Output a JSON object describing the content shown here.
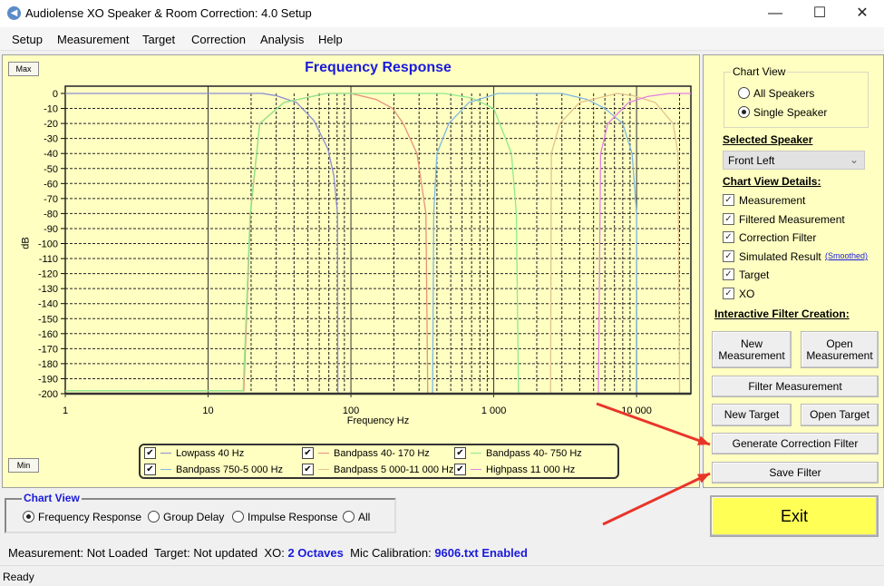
{
  "window": {
    "title": "Audiolense XO Speaker & Room Correction: 4.0 Setup",
    "minimize": "—",
    "maximize": "☐",
    "close": "✕"
  },
  "menu": [
    "Setup",
    "Measurement",
    "Target",
    "Correction",
    "Analysis",
    "Help"
  ],
  "chart_panel": {
    "max_label": "Max",
    "min_label": "Min"
  },
  "chart_data": {
    "type": "line",
    "title": "Frequency Response",
    "xlabel": "Frequency Hz",
    "ylabel": "dB",
    "xscale": "log",
    "xlim": [
      1,
      24000
    ],
    "ylim": [
      -200,
      0
    ],
    "xticks": [
      {
        "v": 1,
        "label": "1"
      },
      {
        "v": 10,
        "label": "10"
      },
      {
        "v": 100,
        "label": "100"
      },
      {
        "v": 1000,
        "label": "1 000"
      },
      {
        "v": 10000,
        "label": "10 000"
      }
    ],
    "yticks": [
      0,
      -10,
      -20,
      -30,
      -40,
      -50,
      -60,
      -70,
      -80,
      -90,
      -100,
      -110,
      -120,
      -130,
      -140,
      -150,
      -160,
      -170,
      -180,
      -190,
      -200
    ],
    "grid": true,
    "background": "#ffffc2",
    "title_color": "#1a1adb",
    "series": [
      {
        "name": "Lowpass  40 Hz",
        "color": "#8c8cd2",
        "points": [
          [
            1,
            0
          ],
          [
            24,
            0
          ],
          [
            30,
            -1.5
          ],
          [
            41.6,
            -6
          ],
          [
            55,
            -18
          ],
          [
            69,
            -37
          ],
          [
            76,
            -55
          ],
          [
            80.5,
            -80
          ],
          [
            81,
            -200
          ],
          [
            24000,
            -200
          ]
        ]
      },
      {
        "name": "Bandpass  40- 170 Hz",
        "color": "#e8907c",
        "points": [
          [
            1,
            -198
          ],
          [
            17.8,
            -198
          ],
          [
            19.8,
            -80
          ],
          [
            23,
            -20
          ],
          [
            34,
            -6
          ],
          [
            67,
            0
          ],
          [
            100,
            0
          ],
          [
            150,
            -4
          ],
          [
            196,
            -10
          ],
          [
            232,
            -20
          ],
          [
            290,
            -40
          ],
          [
            335,
            -80
          ],
          [
            345,
            -200
          ],
          [
            24000,
            -200
          ]
        ]
      },
      {
        "name": "Bandpass  40- 750 Hz",
        "color": "#8ee88e",
        "points": [
          [
            1,
            -198
          ],
          [
            17.6,
            -198
          ],
          [
            19.7,
            -80
          ],
          [
            23,
            -20
          ],
          [
            34,
            -6
          ],
          [
            67,
            0
          ],
          [
            451,
            0
          ],
          [
            700,
            -3
          ],
          [
            1000,
            -10
          ],
          [
            1330,
            -40
          ],
          [
            1440,
            -80
          ],
          [
            1490,
            -200
          ],
          [
            24000,
            -200
          ]
        ]
      },
      {
        "name": "Bandpass  750-5 000 Hz",
        "color": "#80b8e2",
        "points": [
          [
            1,
            -200
          ],
          [
            373,
            -200
          ],
          [
            380,
            -80
          ],
          [
            400,
            -40
          ],
          [
            485,
            -20
          ],
          [
            670,
            -6
          ],
          [
            1070,
            0
          ],
          [
            3000,
            0
          ],
          [
            4500,
            -4
          ],
          [
            6000,
            -10
          ],
          [
            8000,
            -20
          ],
          [
            9300,
            -40
          ],
          [
            10000,
            -80
          ],
          [
            10050,
            -200
          ],
          [
            24000,
            -200
          ]
        ]
      },
      {
        "name": "Bandpass  5 000-11 000 Hz",
        "color": "#e2c28e",
        "points": [
          [
            1,
            -200
          ],
          [
            2500,
            -200
          ],
          [
            2530,
            -40
          ],
          [
            2900,
            -20
          ],
          [
            4000,
            -6
          ],
          [
            7300,
            0
          ],
          [
            9500,
            -1.5
          ],
          [
            13500,
            -6
          ],
          [
            18000,
            -20
          ],
          [
            19500,
            -40
          ],
          [
            20000,
            -200
          ],
          [
            24000,
            -200
          ]
        ]
      },
      {
        "name": "Highpass  11 000 Hz",
        "color": "#e282e2",
        "points": [
          [
            1,
            -200
          ],
          [
            5400,
            -200
          ],
          [
            5600,
            -40
          ],
          [
            6300,
            -20
          ],
          [
            8800,
            -6
          ],
          [
            12000,
            -2
          ],
          [
            17000,
            0
          ],
          [
            24000,
            0
          ]
        ]
      }
    ]
  },
  "chart_view_group": {
    "title": "Chart View",
    "options": [
      "Frequency Response",
      "Group Delay",
      "Impulse Response",
      "All"
    ],
    "selected": 0
  },
  "right_panel": {
    "chart_view": {
      "title": "Chart View",
      "options": [
        "All Speakers",
        "Single Speaker"
      ],
      "selected": 1
    },
    "selected_speaker_label": "Selected Speaker",
    "selected_speaker": "Front Left",
    "details_label": "Chart View Details:",
    "details": [
      "Measurement",
      "Filtered Measurement",
      "Correction Filter",
      "Simulated Result",
      "Target",
      "XO"
    ],
    "smoothed_link": "(Smoothed)",
    "interactive_label": "Interactive Filter Creation:",
    "buttons": {
      "new_measurement": "New Measurement",
      "open_measurement": "Open Measurement",
      "filter_measurement": "Filter Measurement",
      "new_target": "New Target",
      "open_target": "Open Target",
      "generate": "Generate Correction Filter",
      "save": "Save Filter"
    }
  },
  "exit_label": "Exit",
  "status": {
    "measurement_label": "Measurement:",
    "measurement": "Not Loaded",
    "target_label": "Target:",
    "target": "Not updated",
    "xo_label": "XO:",
    "xo": "2 Octaves",
    "mic_label": "Mic Calibration:",
    "mic": "9606.txt Enabled",
    "ready": "Ready"
  },
  "annotation_color": "#e8352a"
}
